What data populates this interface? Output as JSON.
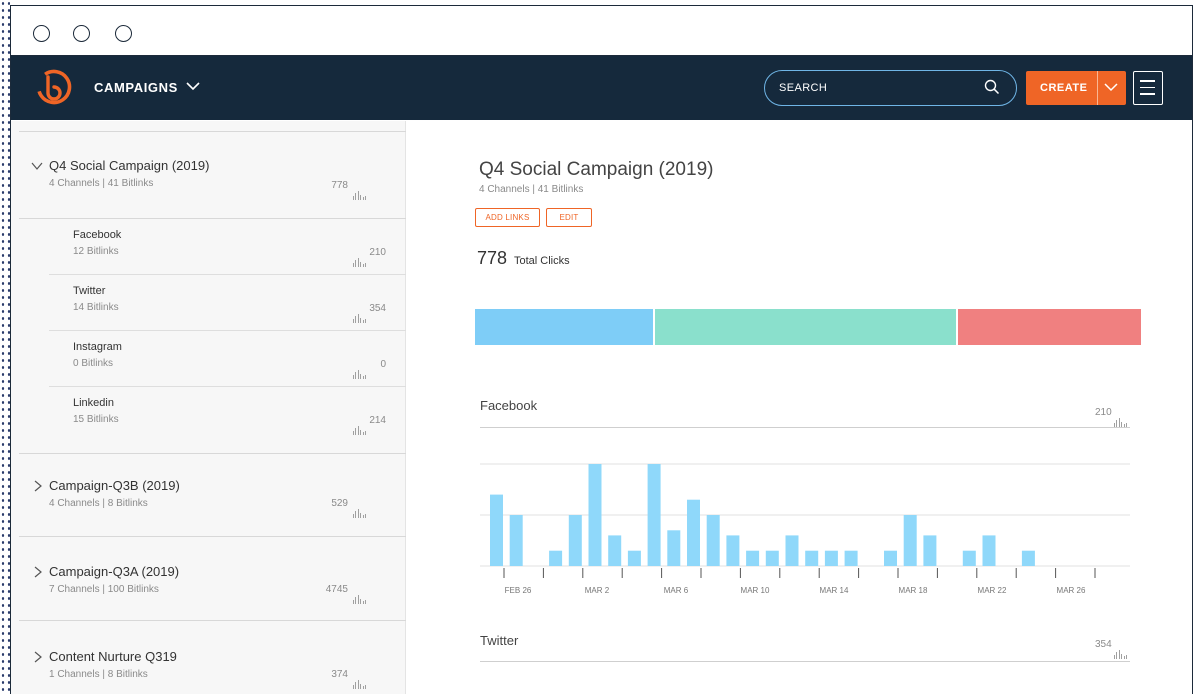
{
  "nav": {
    "section_label": "CAMPAIGNS",
    "search_placeholder": "SEARCH",
    "create_label": "CREATE",
    "colors": {
      "nav_bg": "#15293c",
      "accent": "#ef6526",
      "search_border": "#6fb5e6"
    }
  },
  "sidebar": {
    "campaigns": [
      {
        "name": "Q4 Social Campaign (2019)",
        "meta": "4 Channels  |  41 Bitlinks",
        "clicks": "778",
        "expanded": true,
        "channels": [
          {
            "name": "Facebook",
            "meta": "12 Bitlinks",
            "clicks": "210"
          },
          {
            "name": "Twitter",
            "meta": "14 Bitlinks",
            "clicks": "354"
          },
          {
            "name": "Instagram",
            "meta": "0 Bitlinks",
            "clicks": "0"
          },
          {
            "name": "Linkedin",
            "meta": "15 Bitlinks",
            "clicks": "214"
          }
        ]
      },
      {
        "name": "Campaign-Q3B (2019)",
        "meta": "4 Channels  |  8 Bitlinks",
        "clicks": "529",
        "expanded": false
      },
      {
        "name": "Campaign-Q3A (2019)",
        "meta": "7 Channels  |  100 Bitlinks",
        "clicks": "4745",
        "expanded": false
      },
      {
        "name": "Content Nurture Q319",
        "meta": "1 Channels  |  8 Bitlinks",
        "clicks": "374",
        "expanded": false
      }
    ]
  },
  "main": {
    "title": "Q4 Social Campaign (2019)",
    "meta": "4 Channels  |  41 Bitlinks",
    "add_links_label": "ADD LINKS",
    "edit_label": "EDIT",
    "total_clicks": "778",
    "total_clicks_label": "Total Clicks",
    "channel_breakdown": [
      {
        "channel": "Facebook",
        "clicks": 210,
        "color": "#7ecdf7"
      },
      {
        "channel": "Twitter",
        "clicks": 354,
        "color": "#8ae0cc"
      },
      {
        "channel": "Linkedin",
        "clicks": 214,
        "color": "#f08080"
      }
    ],
    "sections": [
      {
        "title": "Facebook",
        "clicks": "210"
      },
      {
        "title": "Twitter",
        "clicks": "354"
      }
    ]
  },
  "chart_data": {
    "type": "bar",
    "series_color": "#8fd8fa",
    "x_tick_labels": [
      "FEB 26",
      "MAR 2",
      "MAR 6",
      "MAR 10",
      "MAR 14",
      "MAR 18",
      "MAR 22",
      "MAR 26"
    ],
    "values": [
      7,
      5,
      0,
      1.5,
      5,
      10,
      3,
      1.5,
      10,
      3.5,
      6.5,
      5,
      3,
      1.5,
      1.5,
      3,
      1.5,
      1.5,
      1.5,
      0,
      1.5,
      5,
      3,
      0,
      1.5,
      3,
      0,
      1.5,
      0,
      0
    ],
    "ylim": [
      0,
      10
    ],
    "grid": true
  }
}
